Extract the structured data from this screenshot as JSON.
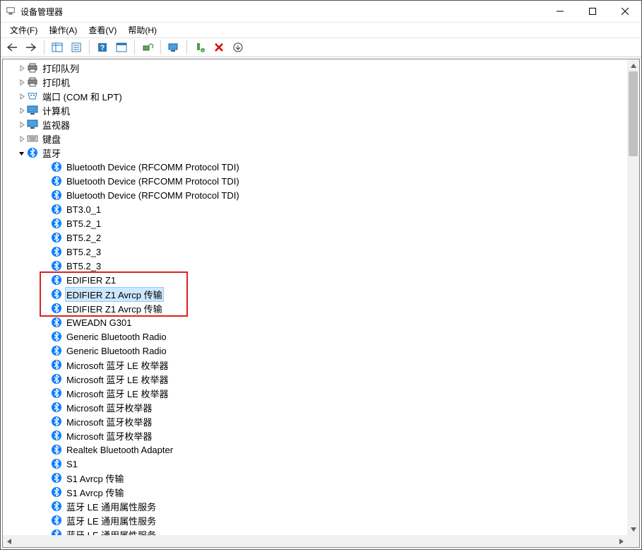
{
  "window": {
    "title": "设备管理器"
  },
  "menu": {
    "file": "文件(F)",
    "action": "操作(A)",
    "view": "查看(V)",
    "help": "帮助(H)"
  },
  "toolbar_icons": [
    "back-arrow",
    "forward-arrow",
    "|",
    "show-panel",
    "properties",
    "|",
    "help",
    "details-toggle",
    "|",
    "scan-hardware",
    "|",
    "monitor-refresh",
    "|",
    "add-device",
    "remove-device",
    "more-actions"
  ],
  "tree": {
    "categories": [
      {
        "label": "打印队列",
        "icon": "printer",
        "expanded": false
      },
      {
        "label": "打印机",
        "icon": "printer",
        "expanded": false
      },
      {
        "label": "端口 (COM 和 LPT)",
        "icon": "port",
        "expanded": false
      },
      {
        "label": "计算机",
        "icon": "monitor",
        "expanded": false
      },
      {
        "label": "监视器",
        "icon": "monitor",
        "expanded": false
      },
      {
        "label": "键盘",
        "icon": "keyboard",
        "expanded": false
      },
      {
        "label": "蓝牙",
        "icon": "bluetooth",
        "expanded": true
      }
    ],
    "bluetooth_children": [
      {
        "label": "Bluetooth Device (RFCOMM Protocol TDI)",
        "selected": false,
        "highlight": false
      },
      {
        "label": "Bluetooth Device (RFCOMM Protocol TDI)",
        "selected": false,
        "highlight": false
      },
      {
        "label": "Bluetooth Device (RFCOMM Protocol TDI)",
        "selected": false,
        "highlight": false
      },
      {
        "label": "BT3.0_1",
        "selected": false,
        "highlight": false
      },
      {
        "label": "BT5.2_1",
        "selected": false,
        "highlight": false
      },
      {
        "label": "BT5.2_2",
        "selected": false,
        "highlight": false
      },
      {
        "label": "BT5.2_3",
        "selected": false,
        "highlight": false
      },
      {
        "label": "BT5.2_3",
        "selected": false,
        "highlight": false
      },
      {
        "label": "EDIFIER Z1",
        "selected": false,
        "highlight": true
      },
      {
        "label": "EDIFIER Z1 Avrcp 传输",
        "selected": true,
        "highlight": true
      },
      {
        "label": "EDIFIER Z1 Avrcp 传输",
        "selected": false,
        "highlight": true
      },
      {
        "label": "EWEADN G301",
        "selected": false,
        "highlight": false
      },
      {
        "label": "Generic Bluetooth Radio",
        "selected": false,
        "highlight": false
      },
      {
        "label": "Generic Bluetooth Radio",
        "selected": false,
        "highlight": false
      },
      {
        "label": "Microsoft 蓝牙 LE 枚举器",
        "selected": false,
        "highlight": false
      },
      {
        "label": "Microsoft 蓝牙 LE 枚举器",
        "selected": false,
        "highlight": false
      },
      {
        "label": "Microsoft 蓝牙 LE 枚举器",
        "selected": false,
        "highlight": false
      },
      {
        "label": "Microsoft 蓝牙枚举器",
        "selected": false,
        "highlight": false
      },
      {
        "label": "Microsoft 蓝牙枚举器",
        "selected": false,
        "highlight": false
      },
      {
        "label": "Microsoft 蓝牙枚举器",
        "selected": false,
        "highlight": false
      },
      {
        "label": "Realtek Bluetooth Adapter",
        "selected": false,
        "highlight": false
      },
      {
        "label": "S1",
        "selected": false,
        "highlight": false
      },
      {
        "label": "S1 Avrcp 传输",
        "selected": false,
        "highlight": false
      },
      {
        "label": "S1 Avrcp 传输",
        "selected": false,
        "highlight": false
      },
      {
        "label": "蓝牙 LE 通用属性服务",
        "selected": false,
        "highlight": false
      },
      {
        "label": "蓝牙 LE 通用属性服务",
        "selected": false,
        "highlight": false
      },
      {
        "label": "蓝牙 LE 通用属性服务",
        "selected": false,
        "highlight": false
      }
    ]
  }
}
